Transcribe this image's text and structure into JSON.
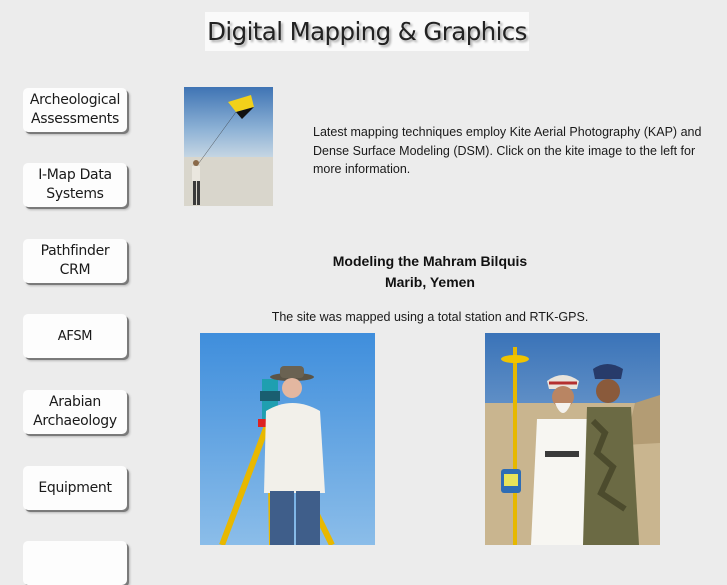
{
  "header": {
    "title": "Digital Mapping & Graphics"
  },
  "nav": {
    "items": [
      {
        "line1": "Archeological",
        "line2": "Assessments"
      },
      {
        "line1": "I-Map Data",
        "line2": "Systems"
      },
      {
        "line1": "Pathfinder",
        "line2": "CRM"
      },
      {
        "line1": "AFSM",
        "line2": ""
      },
      {
        "line1": "Arabian",
        "line2": "Archaeology"
      },
      {
        "line1": "Equipment",
        "line2": ""
      }
    ]
  },
  "main": {
    "intro": "Latest mapping techniques employ Kite Aerial Photography (KAP) and Dense Surface Modeling (DSM). Click on the kite image to the left for more information.",
    "heading_line1": "Modeling the Mahram Bilquis",
    "heading_line2": "Marib, Yemen",
    "subtext": "The site was mapped using a total station and RTK-GPS."
  }
}
